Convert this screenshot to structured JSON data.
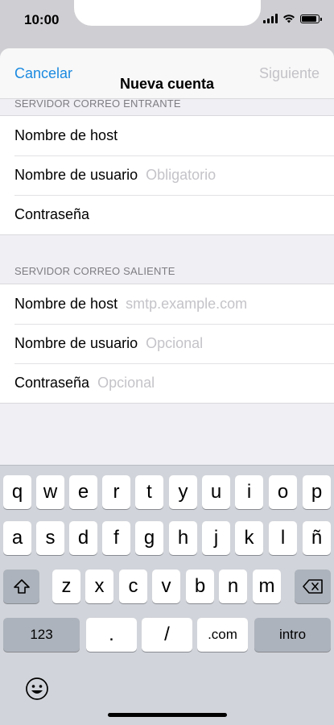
{
  "status_bar": {
    "time": "10:00"
  },
  "nav": {
    "cancel": "Cancelar",
    "title": "Nueva cuenta",
    "next": "Siguiente"
  },
  "incoming": {
    "header": "SERVIDOR CORREO ENTRANTE",
    "rows": [
      {
        "label": "Nombre de host",
        "placeholder": ""
      },
      {
        "label": "Nombre de usuario",
        "placeholder": "Obligatorio"
      },
      {
        "label": "Contraseña",
        "placeholder": ""
      }
    ]
  },
  "outgoing": {
    "header": "SERVIDOR CORREO SALIENTE",
    "rows": [
      {
        "label": "Nombre de host",
        "placeholder": "smtp.example.com"
      },
      {
        "label": "Nombre de usuario",
        "placeholder": "Opcional"
      },
      {
        "label": "Contraseña",
        "placeholder": "Opcional"
      }
    ]
  },
  "keyboard": {
    "row1": [
      "q",
      "w",
      "e",
      "r",
      "t",
      "y",
      "u",
      "i",
      "o",
      "p"
    ],
    "row2": [
      "a",
      "s",
      "d",
      "f",
      "g",
      "h",
      "j",
      "k",
      "l",
      "ñ"
    ],
    "row3": [
      "z",
      "x",
      "c",
      "v",
      "b",
      "n",
      "m"
    ],
    "numbers": "123",
    "dot": ".",
    "slash": "/",
    "dotcom": ".com",
    "return": "intro"
  }
}
